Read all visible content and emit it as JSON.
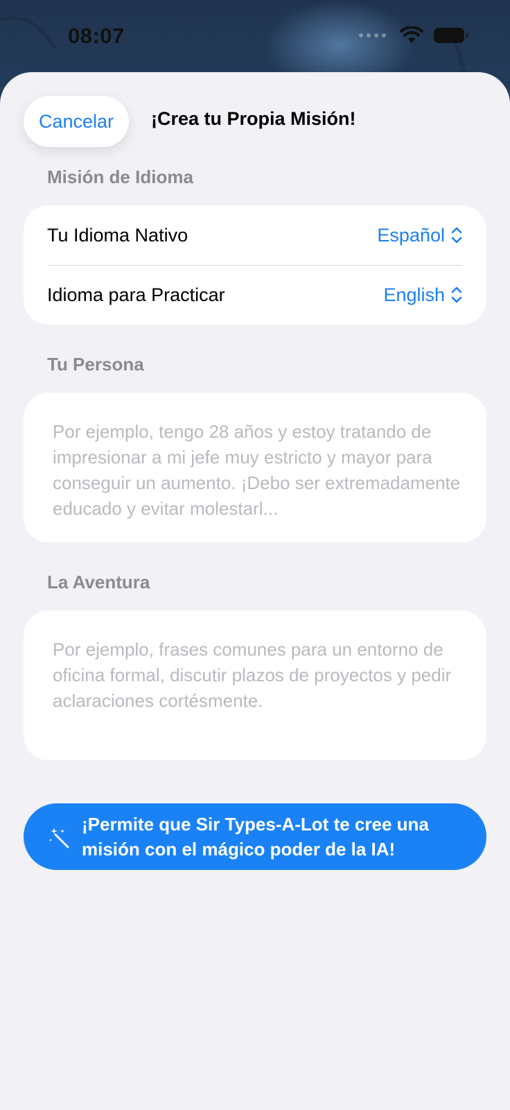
{
  "status_bar": {
    "time": "08:07",
    "icons": [
      "signal-dots-icon",
      "wifi-icon",
      "battery-icon"
    ]
  },
  "header": {
    "cancel_label": "Cancelar",
    "title": "¡Crea tu Propia Misión!"
  },
  "language_section": {
    "label": "Misión de Idioma",
    "rows": [
      {
        "label": "Tu Idioma Nativo",
        "value": "Español"
      },
      {
        "label": "Idioma para Practicar",
        "value": "English"
      }
    ]
  },
  "persona_section": {
    "label": "Tu Persona",
    "placeholder": "Por ejemplo, tengo 28 años y estoy tratando de impresionar a mi jefe muy estricto y mayor para conseguir un aumento. ¡Debo ser extremadamente educado y evitar molestarl..."
  },
  "adventure_section": {
    "label": "La Aventura",
    "placeholder": "Por ejemplo, frases comunes para un entorno de oficina formal, discutir plazos de proyectos y pedir aclaraciones cortésmente."
  },
  "ai_button": {
    "label": "¡Permite que Sir Types-A-Lot te cree una misión con el mágico poder de la IA!",
    "icon": "magic-wand-icon"
  },
  "colors": {
    "accent": "#1a7ff0",
    "sheet_background": "#f1f1f6",
    "section_label": "#8a8a8f",
    "placeholder": "#b9b9bf"
  }
}
